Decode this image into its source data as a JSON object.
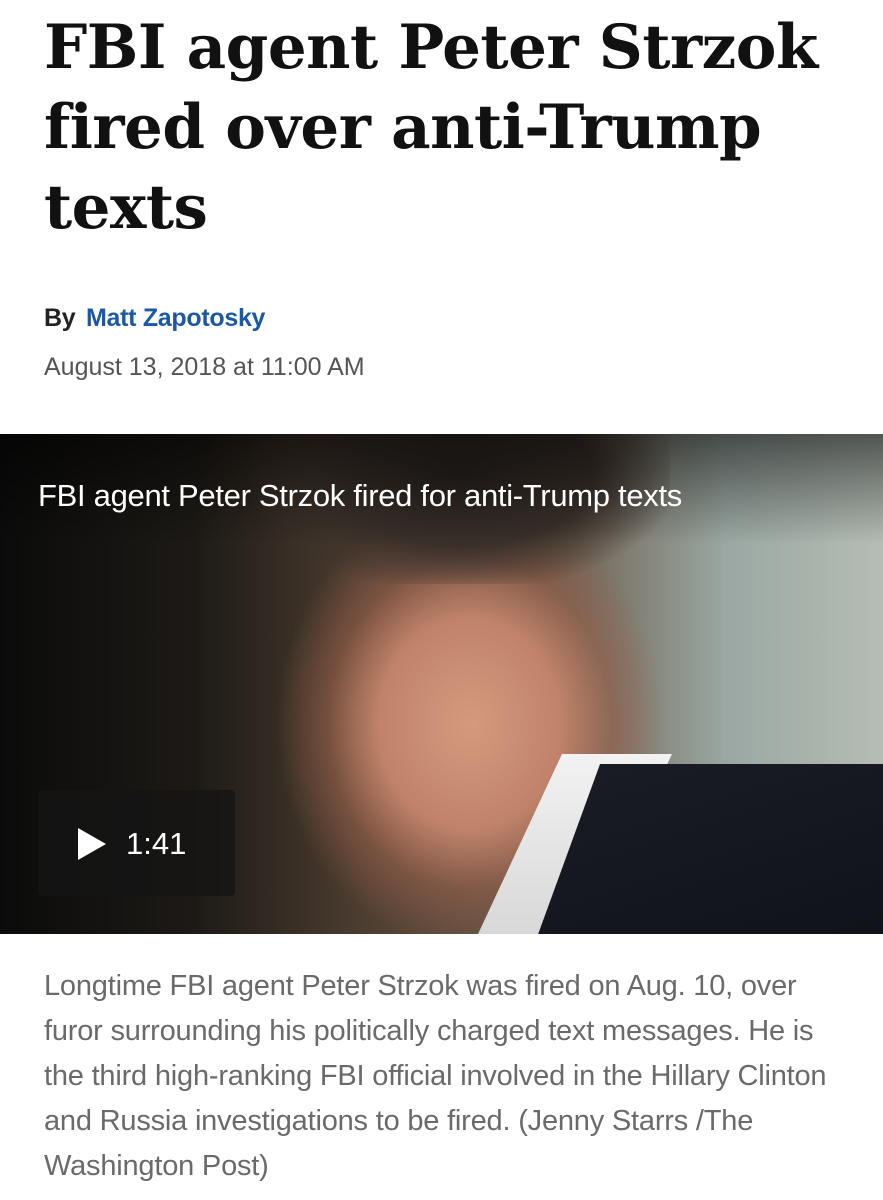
{
  "article": {
    "headline": "FBI agent Peter Strzok fired over anti-Trump texts",
    "byline_prefix": "By",
    "author": "Matt Zapotosky",
    "date": "August 13, 2018 at 11:00 AM"
  },
  "video": {
    "title": "FBI agent Peter Strzok fired for anti-Trump texts",
    "duration": "1:41",
    "play_icon": "play-icon"
  },
  "caption": "Longtime FBI agent Peter Strzok was fired on Aug. 10, over furor surrounding his politically charged text messages. He is the third high-ranking FBI official involved in the Hillary Clinton and Russia investigations to be fired. (Jenny Starrs /The Washington Post)",
  "colors": {
    "author_link": "#1b58a6",
    "headline": "#111111",
    "caption_text": "#6a6a6a"
  }
}
